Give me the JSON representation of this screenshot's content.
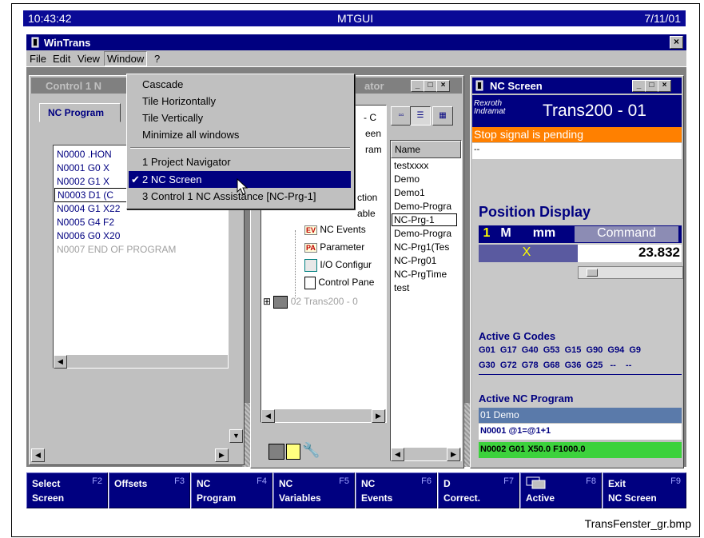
{
  "status_bar": {
    "time": "10:43:42",
    "title": "MTGUI",
    "date": "7/11/01"
  },
  "window": {
    "title": "WinTrans",
    "close": "×"
  },
  "menu": {
    "file": "File",
    "edit": "Edit",
    "view": "View",
    "window": "Window",
    "help": "?"
  },
  "window_menu": {
    "cascade": "Cascade",
    "tile_h": "Tile Horizontally",
    "tile_v": "Tile Vertically",
    "minimize_all": "Minimize all windows",
    "item1": "1 Project Navigator",
    "item2": "2 NC Screen",
    "item3": "3 Control 1  NC Assistance [NC-Prg-1]",
    "check": "✔"
  },
  "control_window": {
    "title": "Control 1  N",
    "tab": "NC Program",
    "lines": [
      "N0000 .HON",
      "N0001 G0 X",
      "N0002 G1 X",
      "N0003 D1 (C",
      "N0004 G1 X22",
      "N0005 G4 F2",
      "N0006 G0 X20",
      "N0007 END OF PROGRAM"
    ]
  },
  "navigator_window": {
    "title": "ator",
    "tree_partial": [
      "- C",
      "een",
      "ram",
      "ction",
      "able"
    ],
    "tree_items": [
      "NC Events",
      "Parameter",
      "I/O Configur",
      "Control Pane",
      "02 Trans200 - 0"
    ],
    "badges": {
      "ev": "EV",
      "pa": "PA"
    },
    "list_header": "Name",
    "list_items": [
      "testxxxx",
      "Demo",
      "Demo1",
      "Demo-Progra",
      "NC-Prg-1",
      "Demo-Progra",
      "NC-Prg1(Tes",
      "NC-Prg01",
      "NC-PrgTime",
      "test"
    ]
  },
  "nc_screen": {
    "title": "NC Screen",
    "brand_line1": "Rexroth",
    "brand_line2": "Indramat",
    "machine": "Trans200 - 01",
    "alarm": "Stop signal is pending",
    "dash": "--",
    "position_heading": "Position Display",
    "pos_cols": {
      "n": "1",
      "m": "M",
      "unit": "mm",
      "mode": "Command"
    },
    "axis": "X",
    "axis_value": "23.832",
    "gcodes_heading": "Active G Codes",
    "gcodes_row1": "G01  G17  G40  G53  G15  G90  G94  G9",
    "gcodes_row2": "G30  G72  G78  G68  G36  G25   --    --",
    "program_heading": "Active NC Program",
    "program_name": "01 Demo",
    "block1": "N0001 @1=@1+1",
    "block2": "N0002 G01 X50.0 F1000.0",
    "colors": {
      "alarm": "#ff8000",
      "header": "#000080",
      "highlight": "#3cd23c"
    }
  },
  "fkeys": [
    {
      "l1": "Select",
      "l2": "Screen",
      "fn": "F2"
    },
    {
      "l1": "Offsets",
      "l2": "",
      "fn": "F3"
    },
    {
      "l1": "NC",
      "l2": "Program",
      "fn": "F4"
    },
    {
      "l1": "NC",
      "l2": "Variables",
      "fn": "F5"
    },
    {
      "l1": "NC",
      "l2": "Events",
      "fn": "F6"
    },
    {
      "l1": "D",
      "l2": "Correct.",
      "fn": "F7"
    },
    {
      "l1": "",
      "l2": "Active",
      "fn": "F8"
    },
    {
      "l1": "Exit",
      "l2": "NC Screen",
      "fn": "F9"
    }
  ],
  "caption": "TransFenster_gr.bmp"
}
